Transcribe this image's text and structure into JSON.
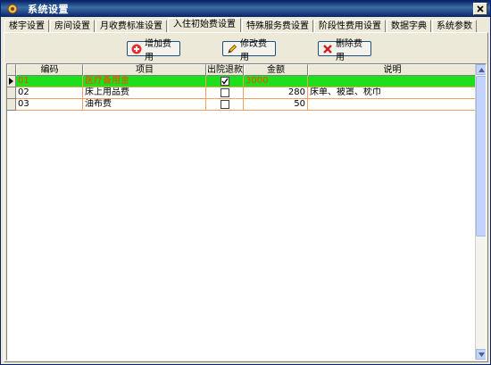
{
  "window": {
    "title": "系统设置"
  },
  "tabs": [
    {
      "label": "楼宇设置"
    },
    {
      "label": "房间设置"
    },
    {
      "label": "月收费标准设置"
    },
    {
      "label": "入住初始费设置"
    },
    {
      "label": "特殊服务费设置"
    },
    {
      "label": "阶段性费用设置"
    },
    {
      "label": "数据字典"
    },
    {
      "label": "系统参数"
    }
  ],
  "active_tab": "入住初始费设置",
  "toolbar": {
    "add_label": "增加费用",
    "edit_label": "修改费用",
    "delete_label": "删除费用"
  },
  "table": {
    "columns": [
      "编码",
      "项目",
      "出院退款",
      "金额",
      "说明"
    ],
    "rows": [
      {
        "code": "01",
        "item": "医疗备用金",
        "refund": true,
        "amount": "3000",
        "note": "",
        "selected": true
      },
      {
        "code": "02",
        "item": "床上用品费",
        "refund": false,
        "amount": "280",
        "note": "床单、被罩、枕巾",
        "selected": false
      },
      {
        "code": "03",
        "item": "油布费",
        "refund": false,
        "amount": "50",
        "note": "",
        "selected": false
      }
    ]
  },
  "colors": {
    "selected_row_bg": "#1de01d",
    "selected_row_text": "#ff4000",
    "grid_line": "#f0a060",
    "title_bar": "#0a246a"
  }
}
